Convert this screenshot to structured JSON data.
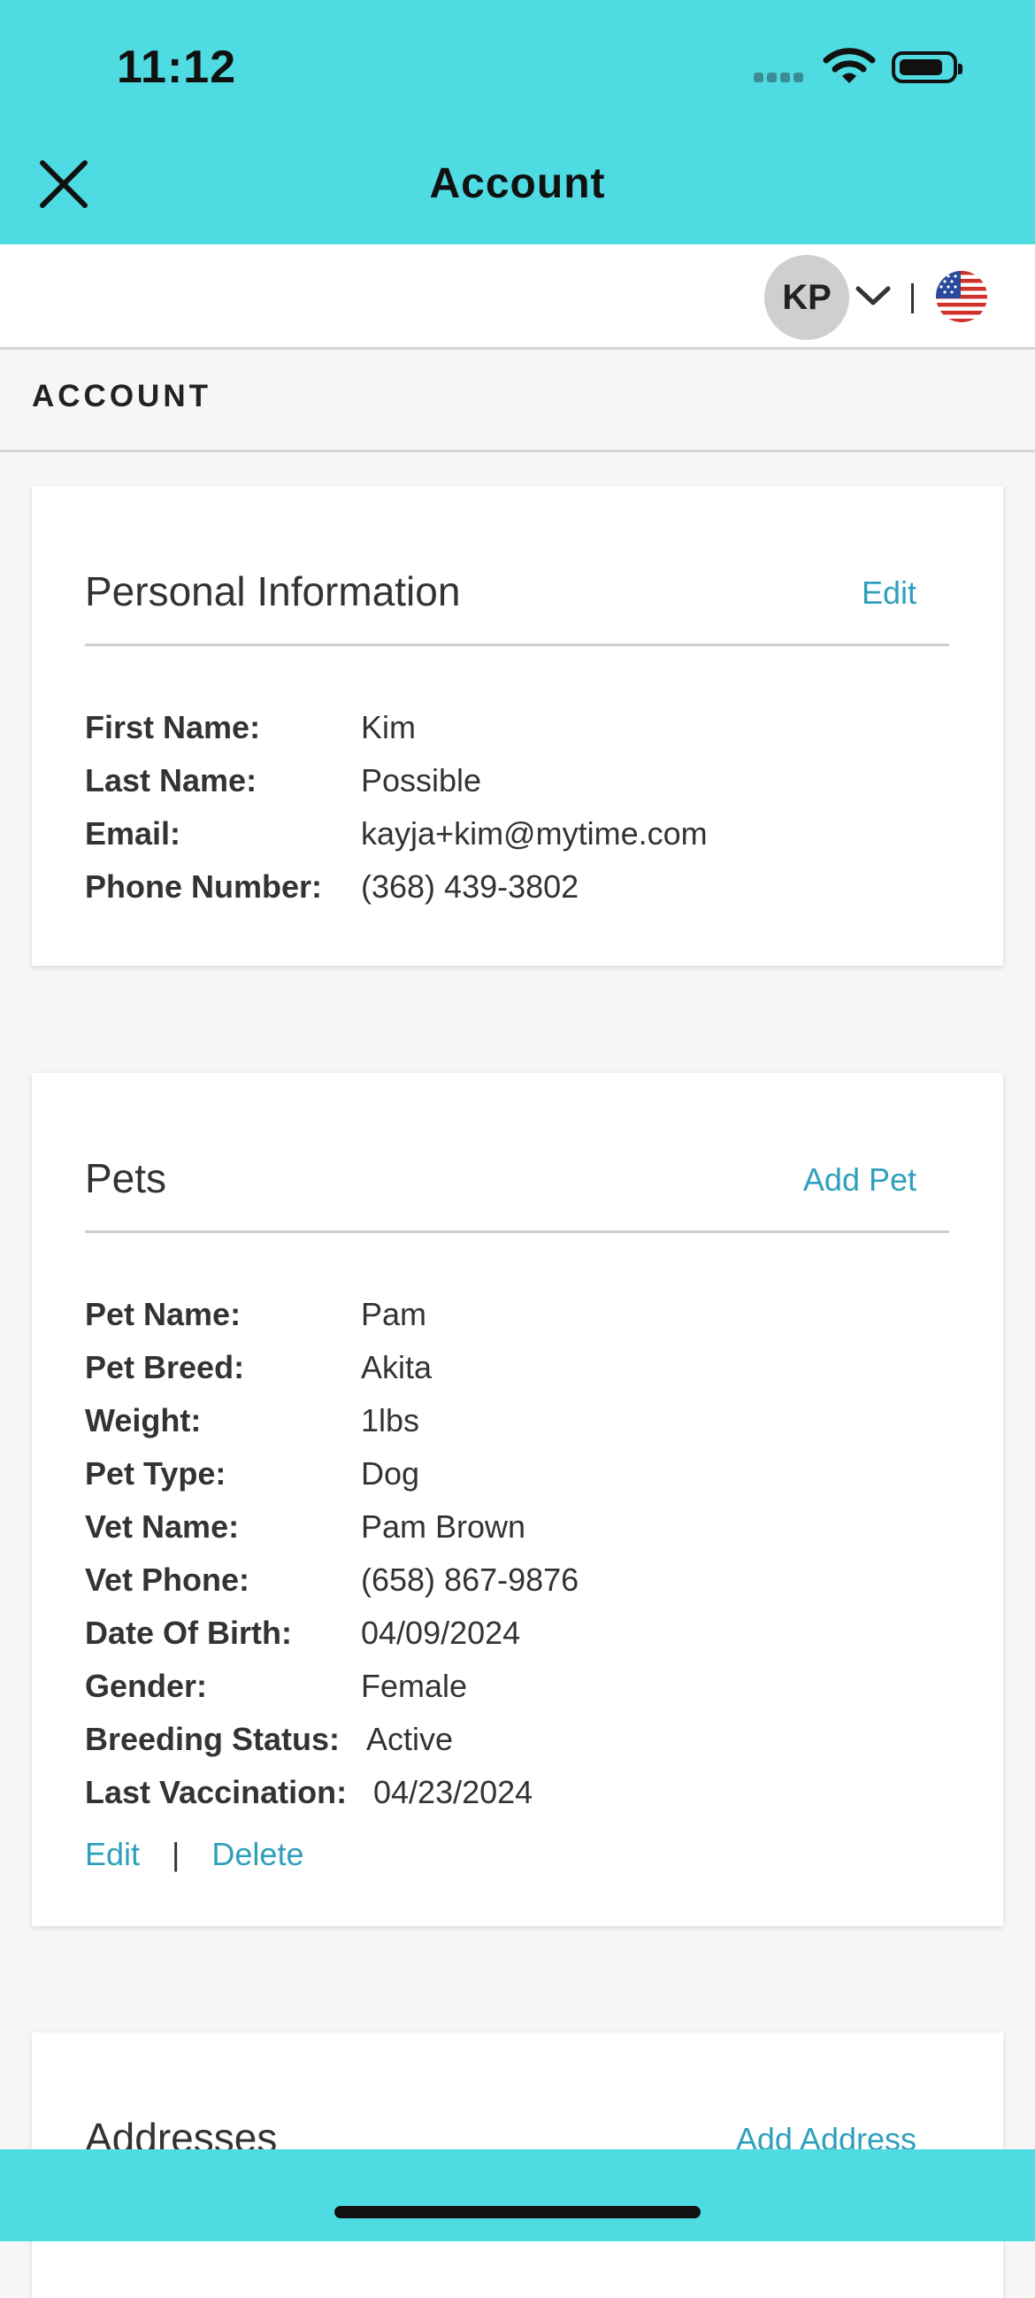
{
  "status_bar": {
    "time": "11:12"
  },
  "header": {
    "title": "Account"
  },
  "user": {
    "initials": "KP"
  },
  "section_label": "ACCOUNT",
  "personal": {
    "title": "Personal Information",
    "edit_label": "Edit",
    "fields": [
      {
        "label": "First Name:",
        "value": "Kim"
      },
      {
        "label": "Last Name:",
        "value": "Possible"
      },
      {
        "label": "Email:",
        "value": "kayja+kim@mytime.com"
      },
      {
        "label": "Phone Number:",
        "value": "(368) 439-3802"
      }
    ]
  },
  "pets": {
    "title": "Pets",
    "add_label": "Add Pet",
    "fields": [
      {
        "label": "Pet Name:",
        "value": "Pam"
      },
      {
        "label": "Pet Breed:",
        "value": "Akita"
      },
      {
        "label": "Weight:",
        "value": "1lbs"
      },
      {
        "label": "Pet Type:",
        "value": "Dog"
      },
      {
        "label": "Vet Name:",
        "value": "Pam Brown"
      },
      {
        "label": "Vet Phone:",
        "value": "(658) 867-9876"
      },
      {
        "label": "Date Of Birth:",
        "value": "04/09/2024"
      },
      {
        "label": "Gender:",
        "value": "Female"
      },
      {
        "label": "Breeding Status:",
        "value": "Active"
      },
      {
        "label": "Last Vaccination:",
        "value": "04/23/2024"
      }
    ],
    "edit_label": "Edit",
    "separator": "|",
    "delete_label": "Delete"
  },
  "addresses": {
    "title": "Addresses",
    "add_label": "Add Address"
  },
  "colors": {
    "header_bg": "#4fdbe2",
    "link": "#2fa0bc"
  }
}
